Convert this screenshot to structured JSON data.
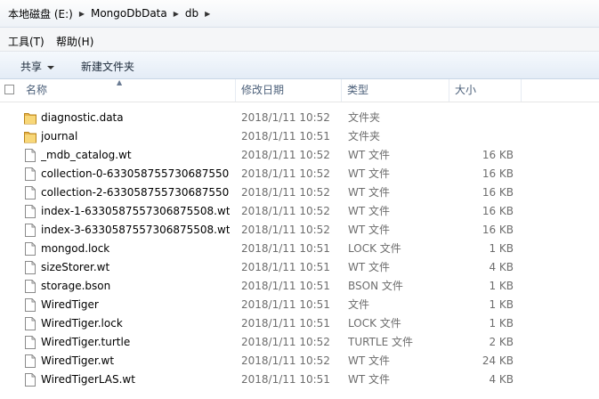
{
  "address": {
    "crumbs": [
      "本地磁盘 (E:)",
      "MongoDbData",
      "db"
    ]
  },
  "menu": {
    "tools": "工具(T)",
    "help": "帮助(H)"
  },
  "toolbar": {
    "share": "共享",
    "new_folder": "新建文件夹"
  },
  "columns": {
    "name": "名称",
    "date": "修改日期",
    "type": "类型",
    "size": "大小"
  },
  "files": [
    {
      "name": "diagnostic.data",
      "date": "2018/1/11 10:52",
      "type": "文件夹",
      "size": "",
      "icon": "folder-icon"
    },
    {
      "name": "journal",
      "date": "2018/1/11 10:51",
      "type": "文件夹",
      "size": "",
      "icon": "folder-icon"
    },
    {
      "name": "_mdb_catalog.wt",
      "date": "2018/1/11 10:52",
      "type": "WT 文件",
      "size": "16 KB",
      "icon": "file-icon"
    },
    {
      "name": "collection-0-633058755730687550...",
      "date": "2018/1/11 10:52",
      "type": "WT 文件",
      "size": "16 KB",
      "icon": "file-icon"
    },
    {
      "name": "collection-2-633058755730687550...",
      "date": "2018/1/11 10:52",
      "type": "WT 文件",
      "size": "16 KB",
      "icon": "file-icon"
    },
    {
      "name": "index-1-6330587557306875508.wt",
      "date": "2018/1/11 10:52",
      "type": "WT 文件",
      "size": "16 KB",
      "icon": "file-icon"
    },
    {
      "name": "index-3-6330587557306875508.wt",
      "date": "2018/1/11 10:52",
      "type": "WT 文件",
      "size": "16 KB",
      "icon": "file-icon"
    },
    {
      "name": "mongod.lock",
      "date": "2018/1/11 10:51",
      "type": "LOCK 文件",
      "size": "1 KB",
      "icon": "file-icon"
    },
    {
      "name": "sizeStorer.wt",
      "date": "2018/1/11 10:51",
      "type": "WT 文件",
      "size": "4 KB",
      "icon": "file-icon"
    },
    {
      "name": "storage.bson",
      "date": "2018/1/11 10:51",
      "type": "BSON 文件",
      "size": "1 KB",
      "icon": "file-icon"
    },
    {
      "name": "WiredTiger",
      "date": "2018/1/11 10:51",
      "type": "文件",
      "size": "1 KB",
      "icon": "file-icon"
    },
    {
      "name": "WiredTiger.lock",
      "date": "2018/1/11 10:51",
      "type": "LOCK 文件",
      "size": "1 KB",
      "icon": "file-icon"
    },
    {
      "name": "WiredTiger.turtle",
      "date": "2018/1/11 10:52",
      "type": "TURTLE 文件",
      "size": "2 KB",
      "icon": "file-icon"
    },
    {
      "name": "WiredTiger.wt",
      "date": "2018/1/11 10:52",
      "type": "WT 文件",
      "size": "24 KB",
      "icon": "file-icon"
    },
    {
      "name": "WiredTigerLAS.wt",
      "date": "2018/1/11 10:51",
      "type": "WT 文件",
      "size": "4 KB",
      "icon": "file-icon"
    }
  ]
}
